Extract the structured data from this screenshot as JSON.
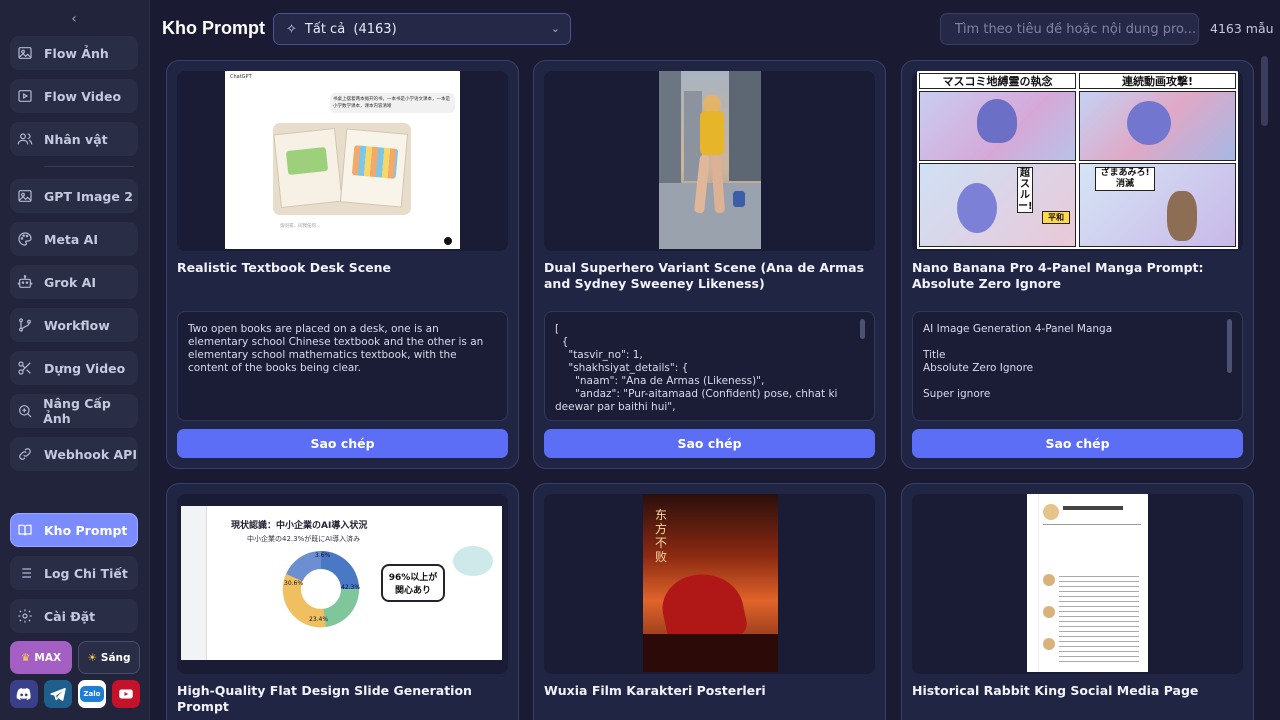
{
  "sidebar": {
    "collapse": "‹",
    "items": [
      {
        "label": "Flow Ảnh"
      },
      {
        "label": "Flow Video"
      },
      {
        "label": "Nhân vật"
      },
      {
        "label": "GPT Image 2"
      },
      {
        "label": "Meta AI"
      },
      {
        "label": "Grok AI"
      },
      {
        "label": "Workflow"
      },
      {
        "label": "Dựng Video"
      },
      {
        "label": "Nâng Cấp Ảnh"
      },
      {
        "label": "Webhook API"
      },
      {
        "label": "Kho Prompt"
      },
      {
        "label": "Log Chi Tiết"
      },
      {
        "label": "Cài Đặt"
      }
    ],
    "max_label": "MAX",
    "light_label": "Sáng",
    "social": {
      "zalo": "Zalo"
    }
  },
  "header": {
    "title": "Kho Prompt",
    "filter_value": "Tất cả  (4163)",
    "search_placeholder": "Tìm theo tiêu đề hoặc nội dung pro...",
    "count": "4163 mẫu"
  },
  "cards": [
    {
      "title": "Realistic Textbook Desk Scene",
      "prompt": "Two open books are placed on a desk, one is an elementary school Chinese textbook and the other is an elementary school mathematics textbook, with the content of the books being clear.",
      "copy": "Sao chép",
      "thumb_text": {
        "app": "ChatGPT",
        "bubble": "书桌上摆着两本摊开的书，一本书是小学语文课本，一本是小学数学课本，课本内容清晰",
        "footer": "询问或…问我任何…"
      }
    },
    {
      "title": "Dual Superhero Variant Scene (Ana de Armas and Sydney Sweeney Likeness)",
      "prompt": "[\n  {\n    \"tasvir_no\": 1,\n    \"shakhsiyat_details\": {\n      \"naam\": \"Ana de Armas (Likeness)\",\n      \"andaz\": \"Pur-aitamaad (Confident) pose, chhat ki deewar par baithi hui\",",
      "copy": "Sao chép"
    },
    {
      "title": "Nano Banana Pro 4-Panel Manga Prompt: Absolute Zero Ignore",
      "prompt": "AI Image Generation 4-Panel Manga\n\nTitle\nAbsolute Zero Ignore\n\nSuper ignore",
      "copy": "Sao chép",
      "thumb_text": {
        "p1": "マスコミ地縛霊の執念",
        "p2": "連続動画攻撃!",
        "p3": "超スルー!",
        "p4": "ざまあみろ!消滅",
        "p5": "平和"
      }
    },
    {
      "title": "High-Quality Flat Design Slide Generation Prompt",
      "thumb_text": {
        "heading": "現状認識：中小企業のAI導入状況",
        "sub": "中小企業の42.3%が既にAI導入済み",
        "callout": "96%以上が関心あり",
        "v1": "42.3%",
        "v2": "30.6%",
        "v3": "23.4%",
        "v4": "3.6%"
      }
    },
    {
      "title": "Wuxia Film Karakteri Posterleri",
      "thumb_text": {
        "poster": "东方不败"
      }
    },
    {
      "title": "Historical Rabbit King Social Media Page"
    }
  ],
  "colors": {
    "accent": "#5b6ef5",
    "active_nav": "#7a8cff",
    "max_badge": "#a45fc4",
    "bg": "#1a1a33"
  }
}
